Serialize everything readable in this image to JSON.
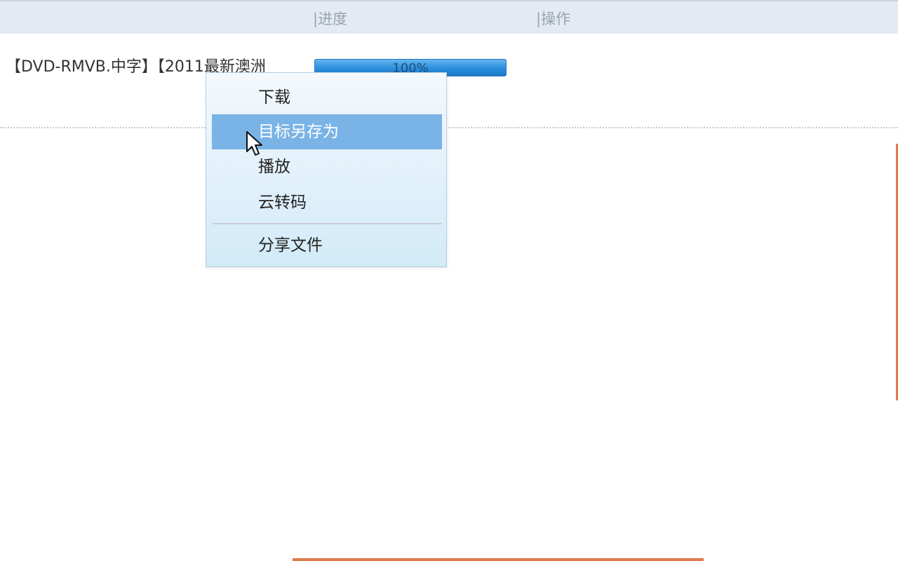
{
  "table_header": {
    "progress_label": "|进度",
    "actions_label": "|操作"
  },
  "file_row": {
    "name": "【DVD-RMVB.中字】【2011最新澳洲",
    "progress_text": "100%",
    "progress_value": 1.0
  },
  "context_menu": {
    "items": [
      {
        "label": "下载"
      },
      {
        "label": "目标另存为",
        "highlighted": true
      },
      {
        "label": "播放"
      },
      {
        "label": "云转码"
      },
      {
        "label": "分享文件"
      }
    ]
  },
  "colors": {
    "header_bg": "#e3eaf2",
    "progress_blue": "#2b8ddb",
    "menu_highlight": "#7ab3e6",
    "accent_orange": "#e07a4b"
  }
}
